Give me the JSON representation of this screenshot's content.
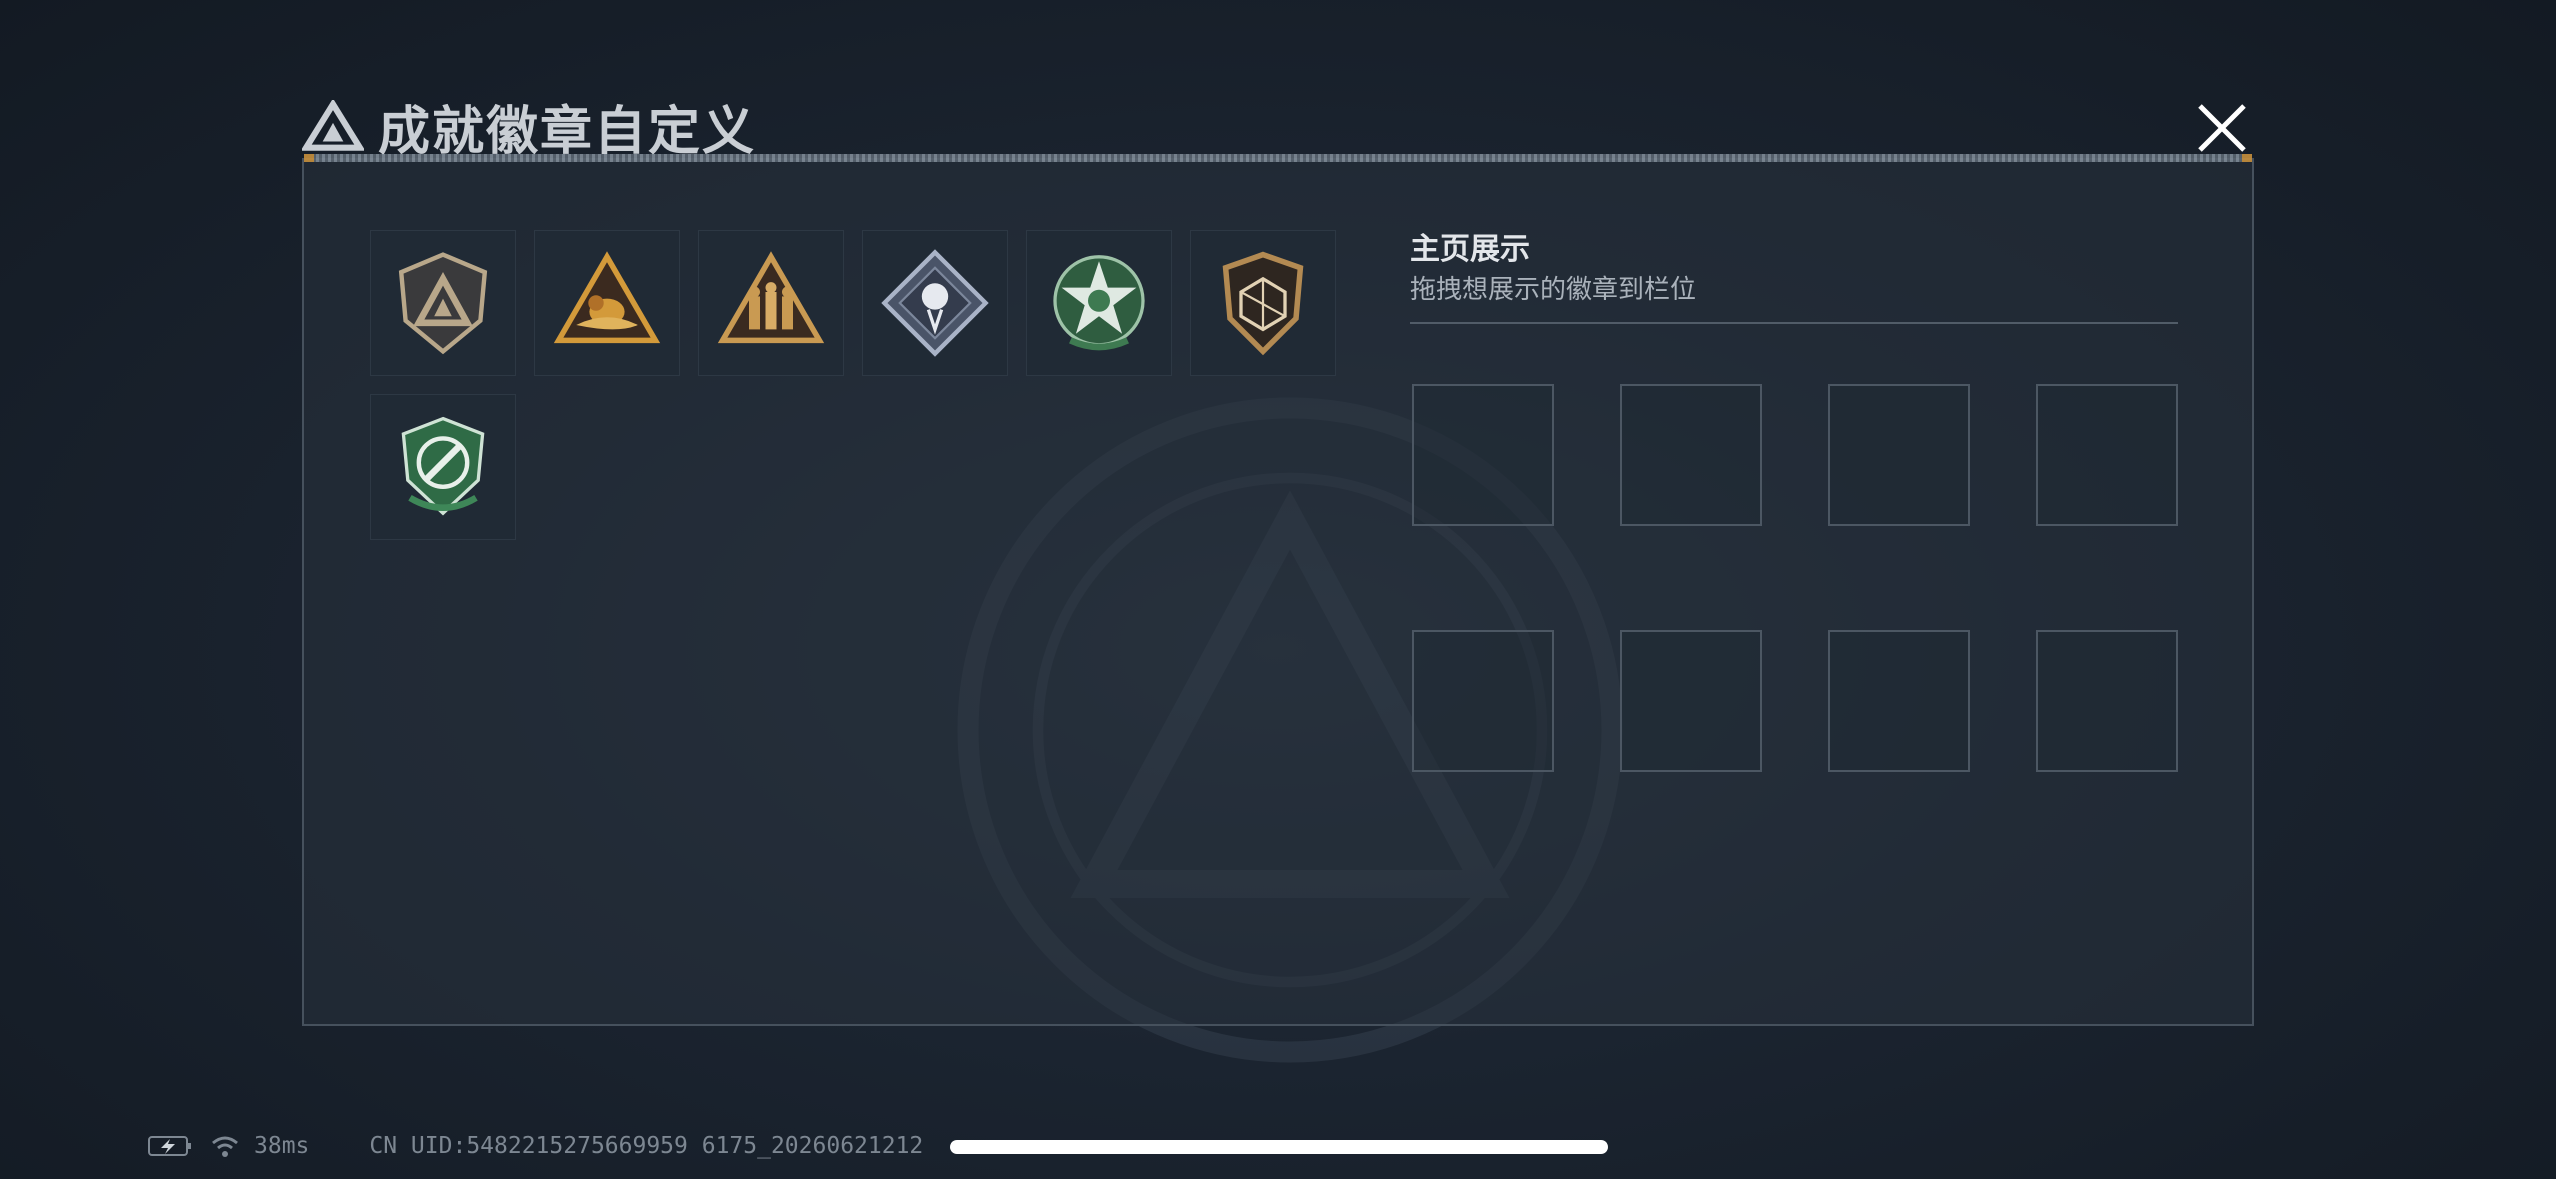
{
  "header": {
    "title": "成就徽章自定义",
    "logo_icon": "triangle-logo-icon",
    "close_icon": "close-icon"
  },
  "badges": [
    {
      "name": "badge-grey-shield",
      "icon": "triangle-shield-badge-icon",
      "accent": "#b8a78a"
    },
    {
      "name": "badge-gold-triangle-bird",
      "icon": "bird-triangle-badge-icon",
      "accent": "#d39a3a"
    },
    {
      "name": "badge-gold-triangle-soldiers",
      "icon": "soldiers-triangle-badge-icon",
      "accent": "#c99a52"
    },
    {
      "name": "badge-rose-diamond",
      "icon": "rose-diamond-badge-icon",
      "accent": "#a9b3c7"
    },
    {
      "name": "badge-green-star",
      "icon": "green-star-badge-icon",
      "accent": "#3e7a51"
    },
    {
      "name": "badge-dice-shield",
      "icon": "dice-shield-badge-icon",
      "accent": "#b38a52"
    },
    {
      "name": "badge-green-target",
      "icon": "target-shield-badge-icon",
      "accent": "#3e8758"
    }
  ],
  "display": {
    "title": "主页展示",
    "hint": "拖拽想展示的徽章到栏位",
    "slot_count": 8
  },
  "status": {
    "battery_icon": "battery-charging-icon",
    "wifi_icon": "wifi-icon",
    "ping": "38ms",
    "uid": "CN UID:5482215275669959 6175_20260621212"
  }
}
